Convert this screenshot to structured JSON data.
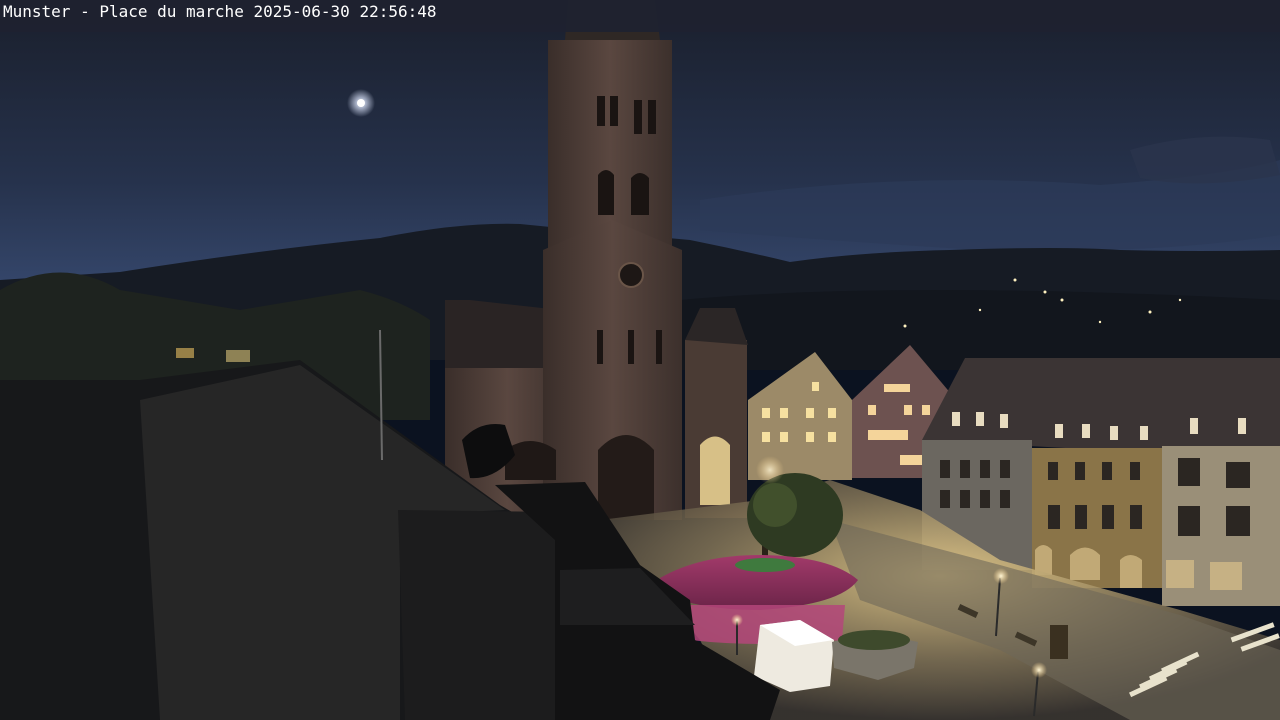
{
  "overlay": {
    "location": "Munster - Place du marche",
    "date": "2025-06-30",
    "time": "22:56:48"
  },
  "scene": {
    "type": "webcam-photo",
    "colors": {
      "sky_top": "#1b2232",
      "sky_horizon": "#34476b",
      "mountains": "#161b24",
      "church_stone": "#4a3a34",
      "window_light": "#ffd88a",
      "street_light": "#fff2c0",
      "foreground_roof": "#101214"
    }
  }
}
